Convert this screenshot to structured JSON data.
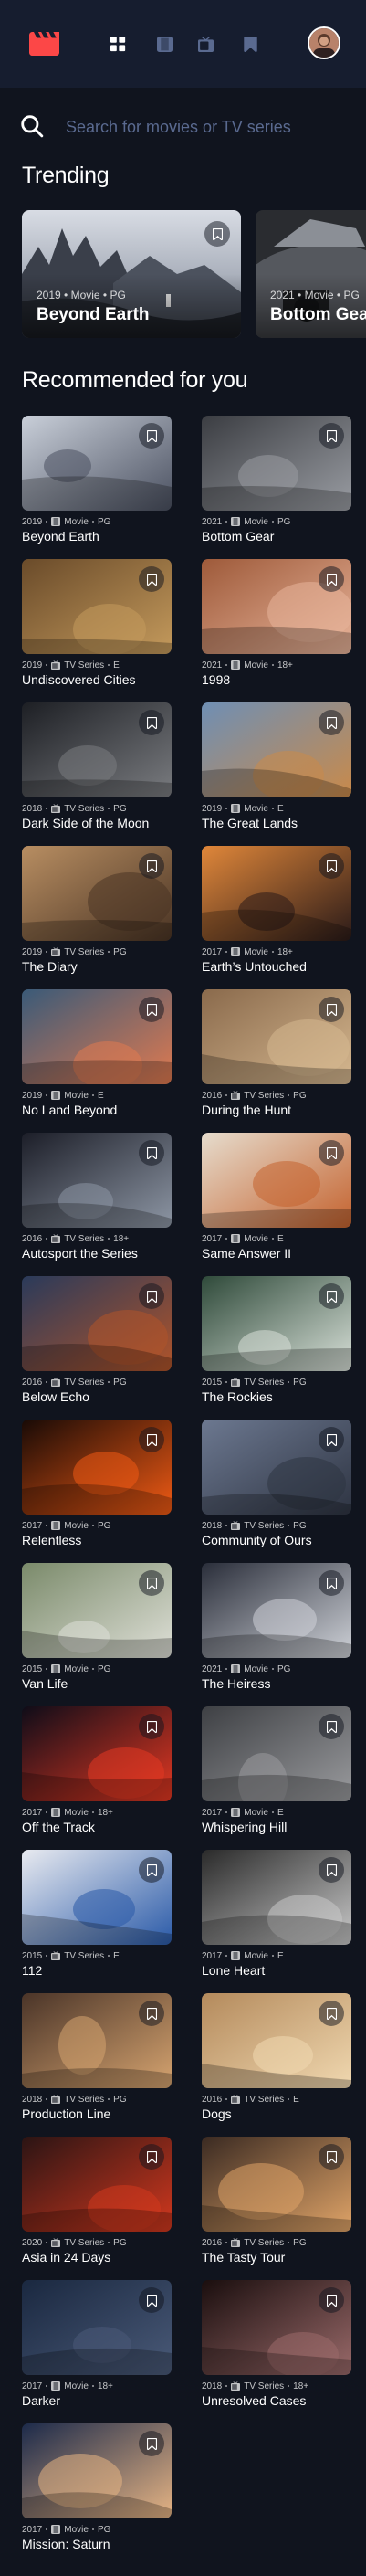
{
  "nav": {
    "logo": "film-logo-icon",
    "items": [
      {
        "name": "home",
        "icon": "grid-icon",
        "active": true
      },
      {
        "name": "movies",
        "icon": "film-icon",
        "active": false
      },
      {
        "name": "tv_series",
        "icon": "tv-icon",
        "active": false
      },
      {
        "name": "bookmarks",
        "icon": "bookmark-icon",
        "active": false
      }
    ],
    "avatar": "avatar"
  },
  "search": {
    "placeholder": "Search for movies or TV series",
    "value": ""
  },
  "colors": {
    "background": "#10141e",
    "nav": "#161d2f",
    "muted": "#5a6a90",
    "accent": "#fc4747"
  },
  "trending": {
    "title": "Trending",
    "items": [
      {
        "year": "2019",
        "category": "Movie",
        "rating": "PG",
        "title": "Beyond Earth"
      },
      {
        "year": "2021",
        "category": "Movie",
        "rating": "PG",
        "title": "Bottom Gear"
      }
    ]
  },
  "recommended": {
    "title": "Recommended for you",
    "items": [
      {
        "year": "2019",
        "category": "Movie",
        "rating": "PG",
        "title": "Beyond Earth"
      },
      {
        "year": "2021",
        "category": "Movie",
        "rating": "PG",
        "title": "Bottom Gear"
      },
      {
        "year": "2019",
        "category": "TV Series",
        "rating": "E",
        "title": "Undiscovered Cities"
      },
      {
        "year": "2021",
        "category": "Movie",
        "rating": "18+",
        "title": "1998"
      },
      {
        "year": "2018",
        "category": "TV Series",
        "rating": "PG",
        "title": "Dark Side of the Moon"
      },
      {
        "year": "2019",
        "category": "Movie",
        "rating": "E",
        "title": "The Great Lands"
      },
      {
        "year": "2019",
        "category": "TV Series",
        "rating": "PG",
        "title": "The Diary"
      },
      {
        "year": "2017",
        "category": "Movie",
        "rating": "18+",
        "title": "Earth’s Untouched"
      },
      {
        "year": "2019",
        "category": "Movie",
        "rating": "E",
        "title": "No Land Beyond"
      },
      {
        "year": "2016",
        "category": "TV Series",
        "rating": "PG",
        "title": "During the Hunt"
      },
      {
        "year": "2016",
        "category": "TV Series",
        "rating": "18+",
        "title": "Autosport the Series"
      },
      {
        "year": "2017",
        "category": "Movie",
        "rating": "E",
        "title": "Same Answer II"
      },
      {
        "year": "2016",
        "category": "TV Series",
        "rating": "PG",
        "title": "Below Echo"
      },
      {
        "year": "2015",
        "category": "TV Series",
        "rating": "PG",
        "title": "The Rockies"
      },
      {
        "year": "2017",
        "category": "Movie",
        "rating": "PG",
        "title": "Relentless"
      },
      {
        "year": "2018",
        "category": "TV Series",
        "rating": "PG",
        "title": "Community of Ours"
      },
      {
        "year": "2015",
        "category": "Movie",
        "rating": "PG",
        "title": "Van Life"
      },
      {
        "year": "2021",
        "category": "Movie",
        "rating": "PG",
        "title": "The Heiress"
      },
      {
        "year": "2017",
        "category": "Movie",
        "rating": "18+",
        "title": "Off the Track"
      },
      {
        "year": "2017",
        "category": "Movie",
        "rating": "E",
        "title": "Whispering Hill"
      },
      {
        "year": "2015",
        "category": "TV Series",
        "rating": "E",
        "title": "112"
      },
      {
        "year": "2017",
        "category": "Movie",
        "rating": "E",
        "title": "Lone Heart"
      },
      {
        "year": "2018",
        "category": "TV Series",
        "rating": "PG",
        "title": "Production Line"
      },
      {
        "year": "2016",
        "category": "TV Series",
        "rating": "E",
        "title": "Dogs"
      },
      {
        "year": "2020",
        "category": "TV Series",
        "rating": "PG",
        "title": "Asia in 24 Days"
      },
      {
        "year": "2016",
        "category": "TV Series",
        "rating": "PG",
        "title": "The Tasty Tour"
      },
      {
        "year": "2017",
        "category": "Movie",
        "rating": "18+",
        "title": "Darker"
      },
      {
        "year": "2018",
        "category": "TV Series",
        "rating": "18+",
        "title": "Unresolved Cases"
      },
      {
        "year": "2017",
        "category": "Movie",
        "rating": "PG",
        "title": "Mission: Saturn"
      }
    ]
  }
}
